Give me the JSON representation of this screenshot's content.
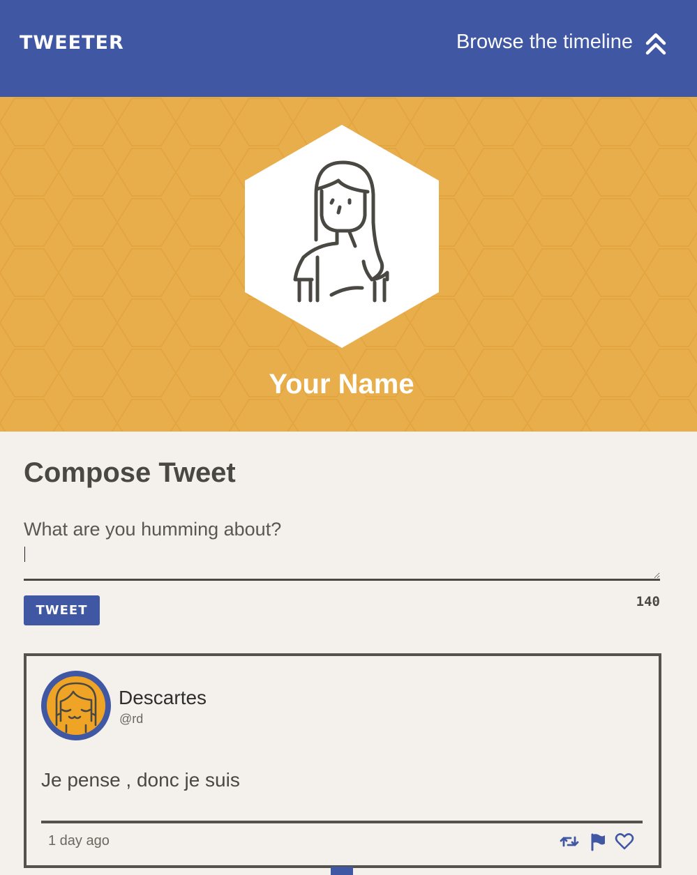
{
  "nav": {
    "brand": "TWEETER",
    "browse_strong": "Browse",
    "browse_rest": " the timeline",
    "toggle_icon": "double-chevron-up-icon"
  },
  "profile": {
    "name": "Your Name",
    "avatar_icon": "person-avatar-icon",
    "background_color": "#e9ae4c"
  },
  "compose": {
    "title": "Compose Tweet",
    "placeholder": "What are you humming about?",
    "value": "",
    "button_label": "TWEET",
    "counter": "140"
  },
  "tweets": [
    {
      "name": "Descartes",
      "handle": "@rd",
      "body": "Je pense , donc je suis",
      "time": "1 day ago",
      "avatar_icon": "smiling-avatar-icon",
      "actions": [
        "retweet-icon",
        "flag-icon",
        "heart-icon"
      ]
    }
  ],
  "colors": {
    "primary": "#4057a3",
    "accent": "#e9ae4c",
    "text": "#4a4843",
    "page_background": "#f4f1ec"
  }
}
